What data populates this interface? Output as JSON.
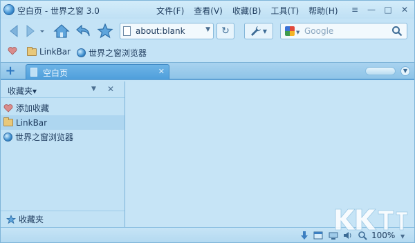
{
  "window": {
    "title": "空白页 - 世界之窗 3.0",
    "controls": [
      "≡",
      "—",
      "□",
      "✕"
    ]
  },
  "menu": [
    "文件(F)",
    "查看(V)",
    "收藏(B)",
    "工具(T)",
    "帮助(H)"
  ],
  "address": {
    "value": "about:blank"
  },
  "search": {
    "placeholder": "Google",
    "engine_icon": "google-icon"
  },
  "links": [
    {
      "label": "LinkBar",
      "icon": "folder-icon"
    },
    {
      "label": "世界之窗浏览器",
      "icon": "globe-icon"
    }
  ],
  "tabs": [
    {
      "label": "空白页",
      "active": true
    }
  ],
  "sidebar": {
    "title": "收藏夹▾",
    "items": [
      {
        "label": "添加收藏",
        "icon": "heart-icon"
      },
      {
        "label": "LinkBar",
        "icon": "folder-icon"
      },
      {
        "label": "世界之窗浏览器",
        "icon": "globe-icon"
      }
    ],
    "footer": "收藏夹"
  },
  "status": {
    "zoom": "100%"
  },
  "watermark": "KK下载",
  "colors": {
    "accent": "#4f9fdb",
    "background": "#c4e3f6",
    "border": "#7eb4d8"
  }
}
